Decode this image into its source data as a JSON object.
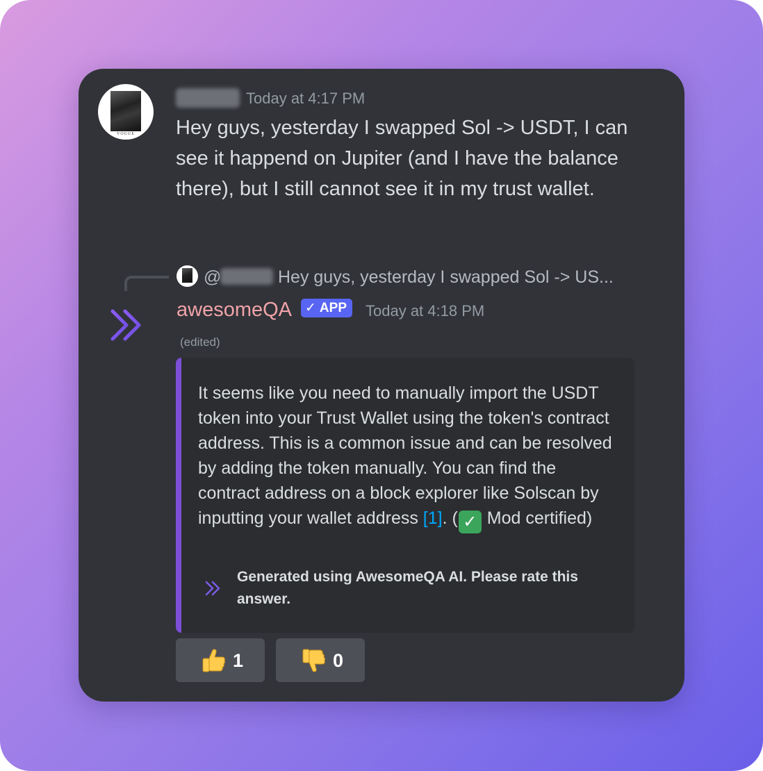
{
  "message1": {
    "timestamp": "Today at 4:17 PM",
    "avatar_caption": "VOGUE",
    "content": "Hey guys, yesterday I swapped Sol -> USDT,  I can see it happend on Jupiter (and I have the balance there), but I still cannot see it in my trust wallet."
  },
  "reply_reference": {
    "at_symbol": "@",
    "preview": "Hey guys, yesterday I swapped Sol -> US..."
  },
  "bot_message": {
    "author": "awesomeQA",
    "badge": "APP",
    "timestamp": "Today at 4:18 PM",
    "edited": "(edited)",
    "embed": {
      "text_part1": "It seems like you need to manually import the USDT token into your Trust Wallet using the token's contract address. This is a common issue and can be resolved by adding the token manually. You can find the contract address on a block explorer like Solscan by inputting your wallet address ",
      "link": "[1]",
      "text_part2": ". (",
      "checkmark": "✓",
      "text_part3": " Mod certified)",
      "footer": "Generated using AwesomeQA AI. Please rate this answer."
    }
  },
  "reactions": [
    {
      "emoji": "thumbs-up",
      "count": "1"
    },
    {
      "emoji": "thumbs-down",
      "count": "0"
    }
  ],
  "colors": {
    "card_bg": "#313338",
    "embed_bg": "#2b2d31",
    "embed_bar": "#7c4fd6",
    "bot_name": "#f0a3a8",
    "badge": "#5865f2",
    "link": "#00a8fc"
  }
}
